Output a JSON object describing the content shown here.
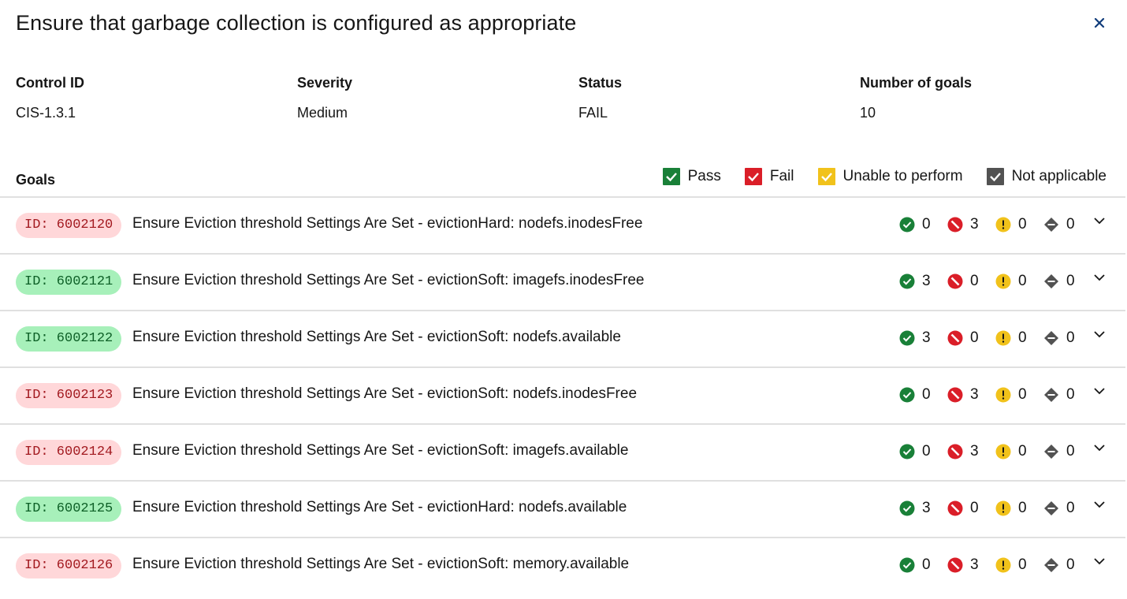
{
  "title": "Ensure that garbage collection is configured as appropriate",
  "meta": {
    "control_id_label": "Control ID",
    "control_id": "CIS-1.3.1",
    "severity_label": "Severity",
    "severity": "Medium",
    "status_label": "Status",
    "status": "FAIL",
    "goals_count_label": "Number of goals",
    "goals_count": "10"
  },
  "goals_label": "Goals",
  "legend": {
    "pass": "Pass",
    "fail": "Fail",
    "unable": "Unable to perform",
    "na": "Not applicable"
  },
  "colors": {
    "pass": "#24a148",
    "fail": "#da1e28",
    "unable": "#f1c21b",
    "na": "#525252"
  },
  "goals": [
    {
      "id": "ID: 6002120",
      "status": "fail",
      "text": "Ensure Eviction threshold Settings Are Set - evictionHard: nodefs.inodesFree",
      "pass": "0",
      "fail": "3",
      "unable": "0",
      "na": "0"
    },
    {
      "id": "ID: 6002121",
      "status": "pass",
      "text": "Ensure Eviction threshold Settings Are Set - evictionSoft: imagefs.inodesFree",
      "pass": "3",
      "fail": "0",
      "unable": "0",
      "na": "0"
    },
    {
      "id": "ID: 6002122",
      "status": "pass",
      "text": "Ensure Eviction threshold Settings Are Set - evictionSoft: nodefs.available",
      "pass": "3",
      "fail": "0",
      "unable": "0",
      "na": "0"
    },
    {
      "id": "ID: 6002123",
      "status": "fail",
      "text": "Ensure Eviction threshold Settings Are Set - evictionSoft: nodefs.inodesFree",
      "pass": "0",
      "fail": "3",
      "unable": "0",
      "na": "0"
    },
    {
      "id": "ID: 6002124",
      "status": "fail",
      "text": "Ensure Eviction threshold Settings Are Set - evictionSoft: imagefs.available",
      "pass": "0",
      "fail": "3",
      "unable": "0",
      "na": "0"
    },
    {
      "id": "ID: 6002125",
      "status": "pass",
      "text": "Ensure Eviction threshold Settings Are Set - evictionHard: nodefs.available",
      "pass": "3",
      "fail": "0",
      "unable": "0",
      "na": "0"
    },
    {
      "id": "ID: 6002126",
      "status": "fail",
      "text": "Ensure Eviction threshold Settings Are Set - evictionSoft: memory.available",
      "pass": "0",
      "fail": "3",
      "unable": "0",
      "na": "0"
    }
  ]
}
